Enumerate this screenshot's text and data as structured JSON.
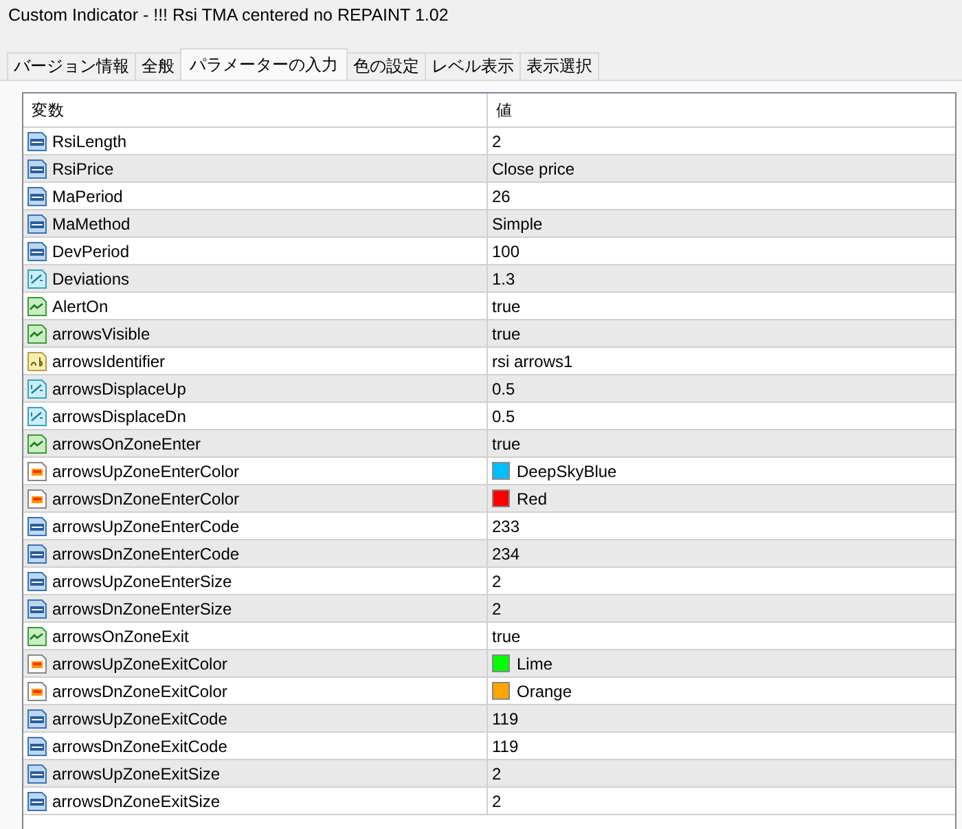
{
  "window": {
    "title": "Custom Indicator - !!! Rsi TMA centered no REPAINT 1.02"
  },
  "tabs": [
    {
      "label": "バージョン情報",
      "selected": false
    },
    {
      "label": "全般",
      "selected": false
    },
    {
      "label": "パラメーターの入力",
      "selected": true
    },
    {
      "label": "色の設定",
      "selected": false
    },
    {
      "label": "レベル表示",
      "selected": false
    },
    {
      "label": "表示選択",
      "selected": false
    }
  ],
  "table": {
    "columns": [
      "変数",
      "値"
    ],
    "rows": [
      {
        "kind": "int",
        "name": "RsiLength",
        "value": "2"
      },
      {
        "kind": "int",
        "name": "RsiPrice",
        "value": "Close price"
      },
      {
        "kind": "int",
        "name": "MaPeriod",
        "value": "26"
      },
      {
        "kind": "int",
        "name": "MaMethod",
        "value": "Simple"
      },
      {
        "kind": "int",
        "name": "DevPeriod",
        "value": "100"
      },
      {
        "kind": "double",
        "name": "Deviations",
        "value": "1.3"
      },
      {
        "kind": "bool",
        "name": "AlertOn",
        "value": "true"
      },
      {
        "kind": "bool",
        "name": "arrowsVisible",
        "value": "true"
      },
      {
        "kind": "string",
        "name": "arrowsIdentifier",
        "value": "rsi arrows1"
      },
      {
        "kind": "double",
        "name": "arrowsDisplaceUp",
        "value": "0.5"
      },
      {
        "kind": "double",
        "name": "arrowsDisplaceDn",
        "value": "0.5"
      },
      {
        "kind": "bool",
        "name": "arrowsOnZoneEnter",
        "value": "true"
      },
      {
        "kind": "color",
        "name": "arrowsUpZoneEnterColor",
        "value": "DeepSkyBlue",
        "color": "#00bfff"
      },
      {
        "kind": "color",
        "name": "arrowsDnZoneEnterColor",
        "value": "Red",
        "color": "#ff0000"
      },
      {
        "kind": "int",
        "name": "arrowsUpZoneEnterCode",
        "value": "233"
      },
      {
        "kind": "int",
        "name": "arrowsDnZoneEnterCode",
        "value": "234"
      },
      {
        "kind": "int",
        "name": "arrowsUpZoneEnterSize",
        "value": "2"
      },
      {
        "kind": "int",
        "name": "arrowsDnZoneEnterSize",
        "value": "2"
      },
      {
        "kind": "bool",
        "name": "arrowsOnZoneExit",
        "value": "true"
      },
      {
        "kind": "color",
        "name": "arrowsUpZoneExitColor",
        "value": "Lime",
        "color": "#00ff00"
      },
      {
        "kind": "color",
        "name": "arrowsDnZoneExitColor",
        "value": "Orange",
        "color": "#ffa500"
      },
      {
        "kind": "int",
        "name": "arrowsUpZoneExitCode",
        "value": "119"
      },
      {
        "kind": "int",
        "name": "arrowsDnZoneExitCode",
        "value": "119"
      },
      {
        "kind": "int",
        "name": "arrowsUpZoneExitSize",
        "value": "2"
      },
      {
        "kind": "int",
        "name": "arrowsDnZoneExitSize",
        "value": "2"
      }
    ]
  }
}
